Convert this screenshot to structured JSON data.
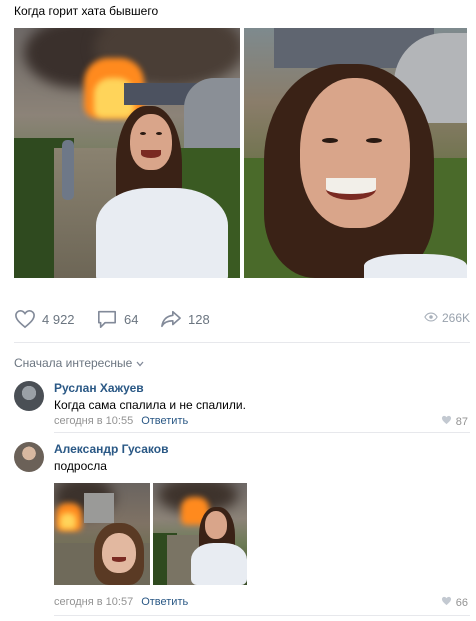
{
  "post": {
    "title": "Когда горит хата бывшего"
  },
  "actions": {
    "likes": "4 922",
    "comments": "64",
    "shares": "128",
    "views": "266K"
  },
  "sort_label": "Сначала интересные",
  "comments": [
    {
      "author": "Руслан Хажуев",
      "text": "Когда сама спалила и не спалили.",
      "time": "сегодня в 10:55",
      "reply": "Ответить",
      "likes": "87"
    },
    {
      "author": "Александр Гусаков",
      "text": "подросла",
      "time": "сегодня в 10:57",
      "reply": "Ответить",
      "likes": "66"
    }
  ],
  "colors": {
    "link": "#2a5885",
    "muted": "#939393",
    "icon": "#6b7580",
    "divider": "#e7e8ec"
  },
  "icons": [
    "heart-icon",
    "comment-icon",
    "share-icon",
    "eye-icon",
    "chevron-down-icon"
  ]
}
